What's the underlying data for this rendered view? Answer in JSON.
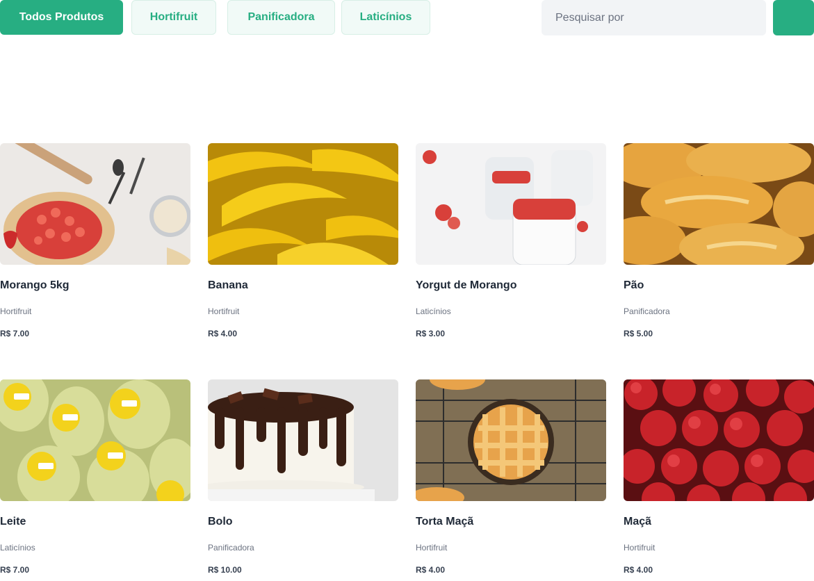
{
  "filters": [
    {
      "label": "Todos Produtos",
      "active": true
    },
    {
      "label": "Hortifruit",
      "active": false
    },
    {
      "label": "Panificadora",
      "active": false
    },
    {
      "label": "Laticínios",
      "active": false
    }
  ],
  "search": {
    "placeholder": "Pesquisar por",
    "value": ""
  },
  "colors": {
    "accent": "#27ae82",
    "accent_light": "#f1faf7"
  },
  "products": [
    {
      "name": "Morango 5kg",
      "category": "Hortifruit",
      "price": "R$ 7.00",
      "image": "strawberry-tart"
    },
    {
      "name": "Banana",
      "category": "Hortifruit",
      "price": "R$ 4.00",
      "image": "bananas"
    },
    {
      "name": "Yorgut de Morango",
      "category": "Laticínios",
      "price": "R$ 3.00",
      "image": "strawberry-yogurt"
    },
    {
      "name": "Pão",
      "category": "Panificadora",
      "price": "R$ 5.00",
      "image": "bread-rolls"
    },
    {
      "name": "Leite",
      "category": "Laticínios",
      "price": "R$ 7.00",
      "image": "milk-bottles"
    },
    {
      "name": "Bolo",
      "category": "Panificadora",
      "price": "R$ 10.00",
      "image": "chocolate-cake"
    },
    {
      "name": "Torta Maçã",
      "category": "Hortifruit",
      "price": "R$ 4.00",
      "image": "apple-pie"
    },
    {
      "name": "Maçã",
      "category": "Hortifruit",
      "price": "R$ 4.00",
      "image": "red-apples"
    }
  ]
}
